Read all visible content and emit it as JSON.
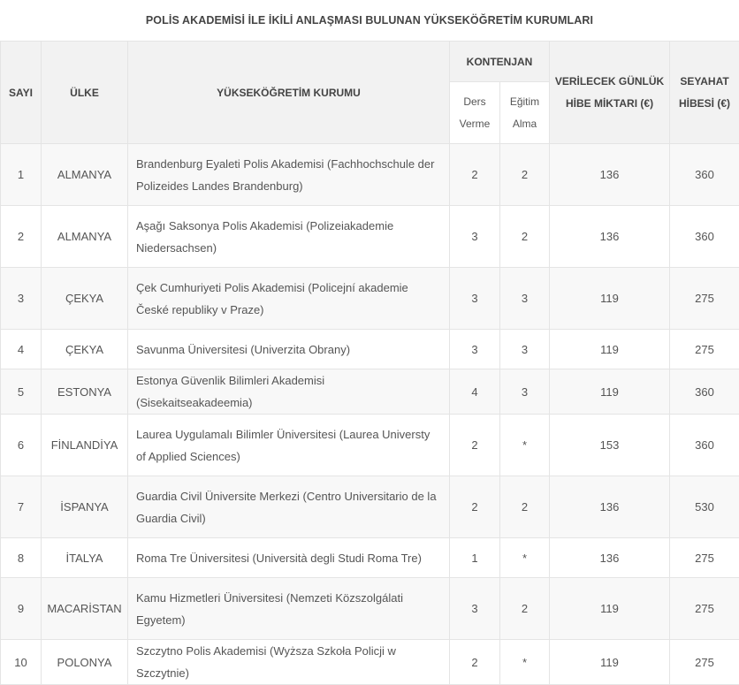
{
  "title": "POLİS AKADEMİSİ İLE İKİLİ ANLAŞMASI BULUNAN YÜKSEKÖĞRETİM KURUMLARI",
  "headers": {
    "sayi": "SAYI",
    "ulke": "ÜLKE",
    "kurum": "YÜKSEKÖĞRETİM KURUMU",
    "kontenjan": "KONTENJAN",
    "ders_verme_1": "Ders",
    "ders_verme_2": "Verme",
    "egitim_alma_1": "Eğitim",
    "egitim_alma_2": "Alma",
    "hibe_1": "VERİLECEK GÜNLÜK",
    "hibe_2": "HİBE MİKTARI (€)",
    "seyahat_1": "SEYAHAT",
    "seyahat_2": "HİBESİ (€)"
  },
  "rows": [
    {
      "no": "1",
      "ulke": "ALMANYA",
      "kurum": "Brandenburg Eyaleti Polis Akademisi (Fachhochschule der Polizeides Landes Brandenburg)",
      "ders": "2",
      "egitim": "2",
      "hibe": "136",
      "seyahat": "360"
    },
    {
      "no": "2",
      "ulke": "ALMANYA",
      "kurum": "Aşağı Saksonya Polis Akademisi (Polizeiakademie Niedersachsen)",
      "ders": "3",
      "egitim": "2",
      "hibe": "136",
      "seyahat": "360"
    },
    {
      "no": "3",
      "ulke": "ÇEKYA",
      "kurum": "Çek Cumhuriyeti Polis Akademisi (Policejní akademie České republiky v Praze)",
      "ders": "3",
      "egitim": "3",
      "hibe": "119",
      "seyahat": "275"
    },
    {
      "no": "4",
      "ulke": "ÇEKYA",
      "kurum": "Savunma Üniversitesi (Univerzita Obrany)",
      "ders": "3",
      "egitim": "3",
      "hibe": "119",
      "seyahat": "275"
    },
    {
      "no": "5",
      "ulke": "ESTONYA",
      "kurum": "Estonya Güvenlik Bilimleri Akademisi (Sisekaitseakadeemia)",
      "ders": "4",
      "egitim": "3",
      "hibe": "119",
      "seyahat": "360"
    },
    {
      "no": "6",
      "ulke": "FİNLANDİYA",
      "kurum": " Laurea Uygulamalı Bilimler Üniversitesi (Laurea Universty of Applied Sciences)",
      "ders": "2",
      "egitim": "*",
      "hibe": "153",
      "seyahat": "360"
    },
    {
      "no": "7",
      "ulke": "İSPANYA",
      "kurum": "Guardia Civil Üniversite Merkezi (Centro Universitario de la Guardia Civil)",
      "ders": "2",
      "egitim": "2",
      "hibe": "136",
      "seyahat": "530"
    },
    {
      "no": "8",
      "ulke": "İTALYA",
      "kurum": "Roma Tre Üniversitesi (Università degli Studi Roma Tre)",
      "ders": "1",
      "egitim": "*",
      "hibe": "136",
      "seyahat": "275"
    },
    {
      "no": "9",
      "ulke": "MACARİSTAN",
      "kurum": "Kamu Hizmetleri Üniversitesi (Nemzeti Közszolgálati Egyetem)",
      "ders": "3",
      "egitim": "2",
      "hibe": "119",
      "seyahat": "275"
    },
    {
      "no": "10",
      "ulke": "POLONYA",
      "kurum": "Szczytno Polis Akademisi (Wyższa Szkoła Policji w Szczytnie)",
      "ders": "2",
      "egitim": "*",
      "hibe": "119",
      "seyahat": "275"
    }
  ]
}
